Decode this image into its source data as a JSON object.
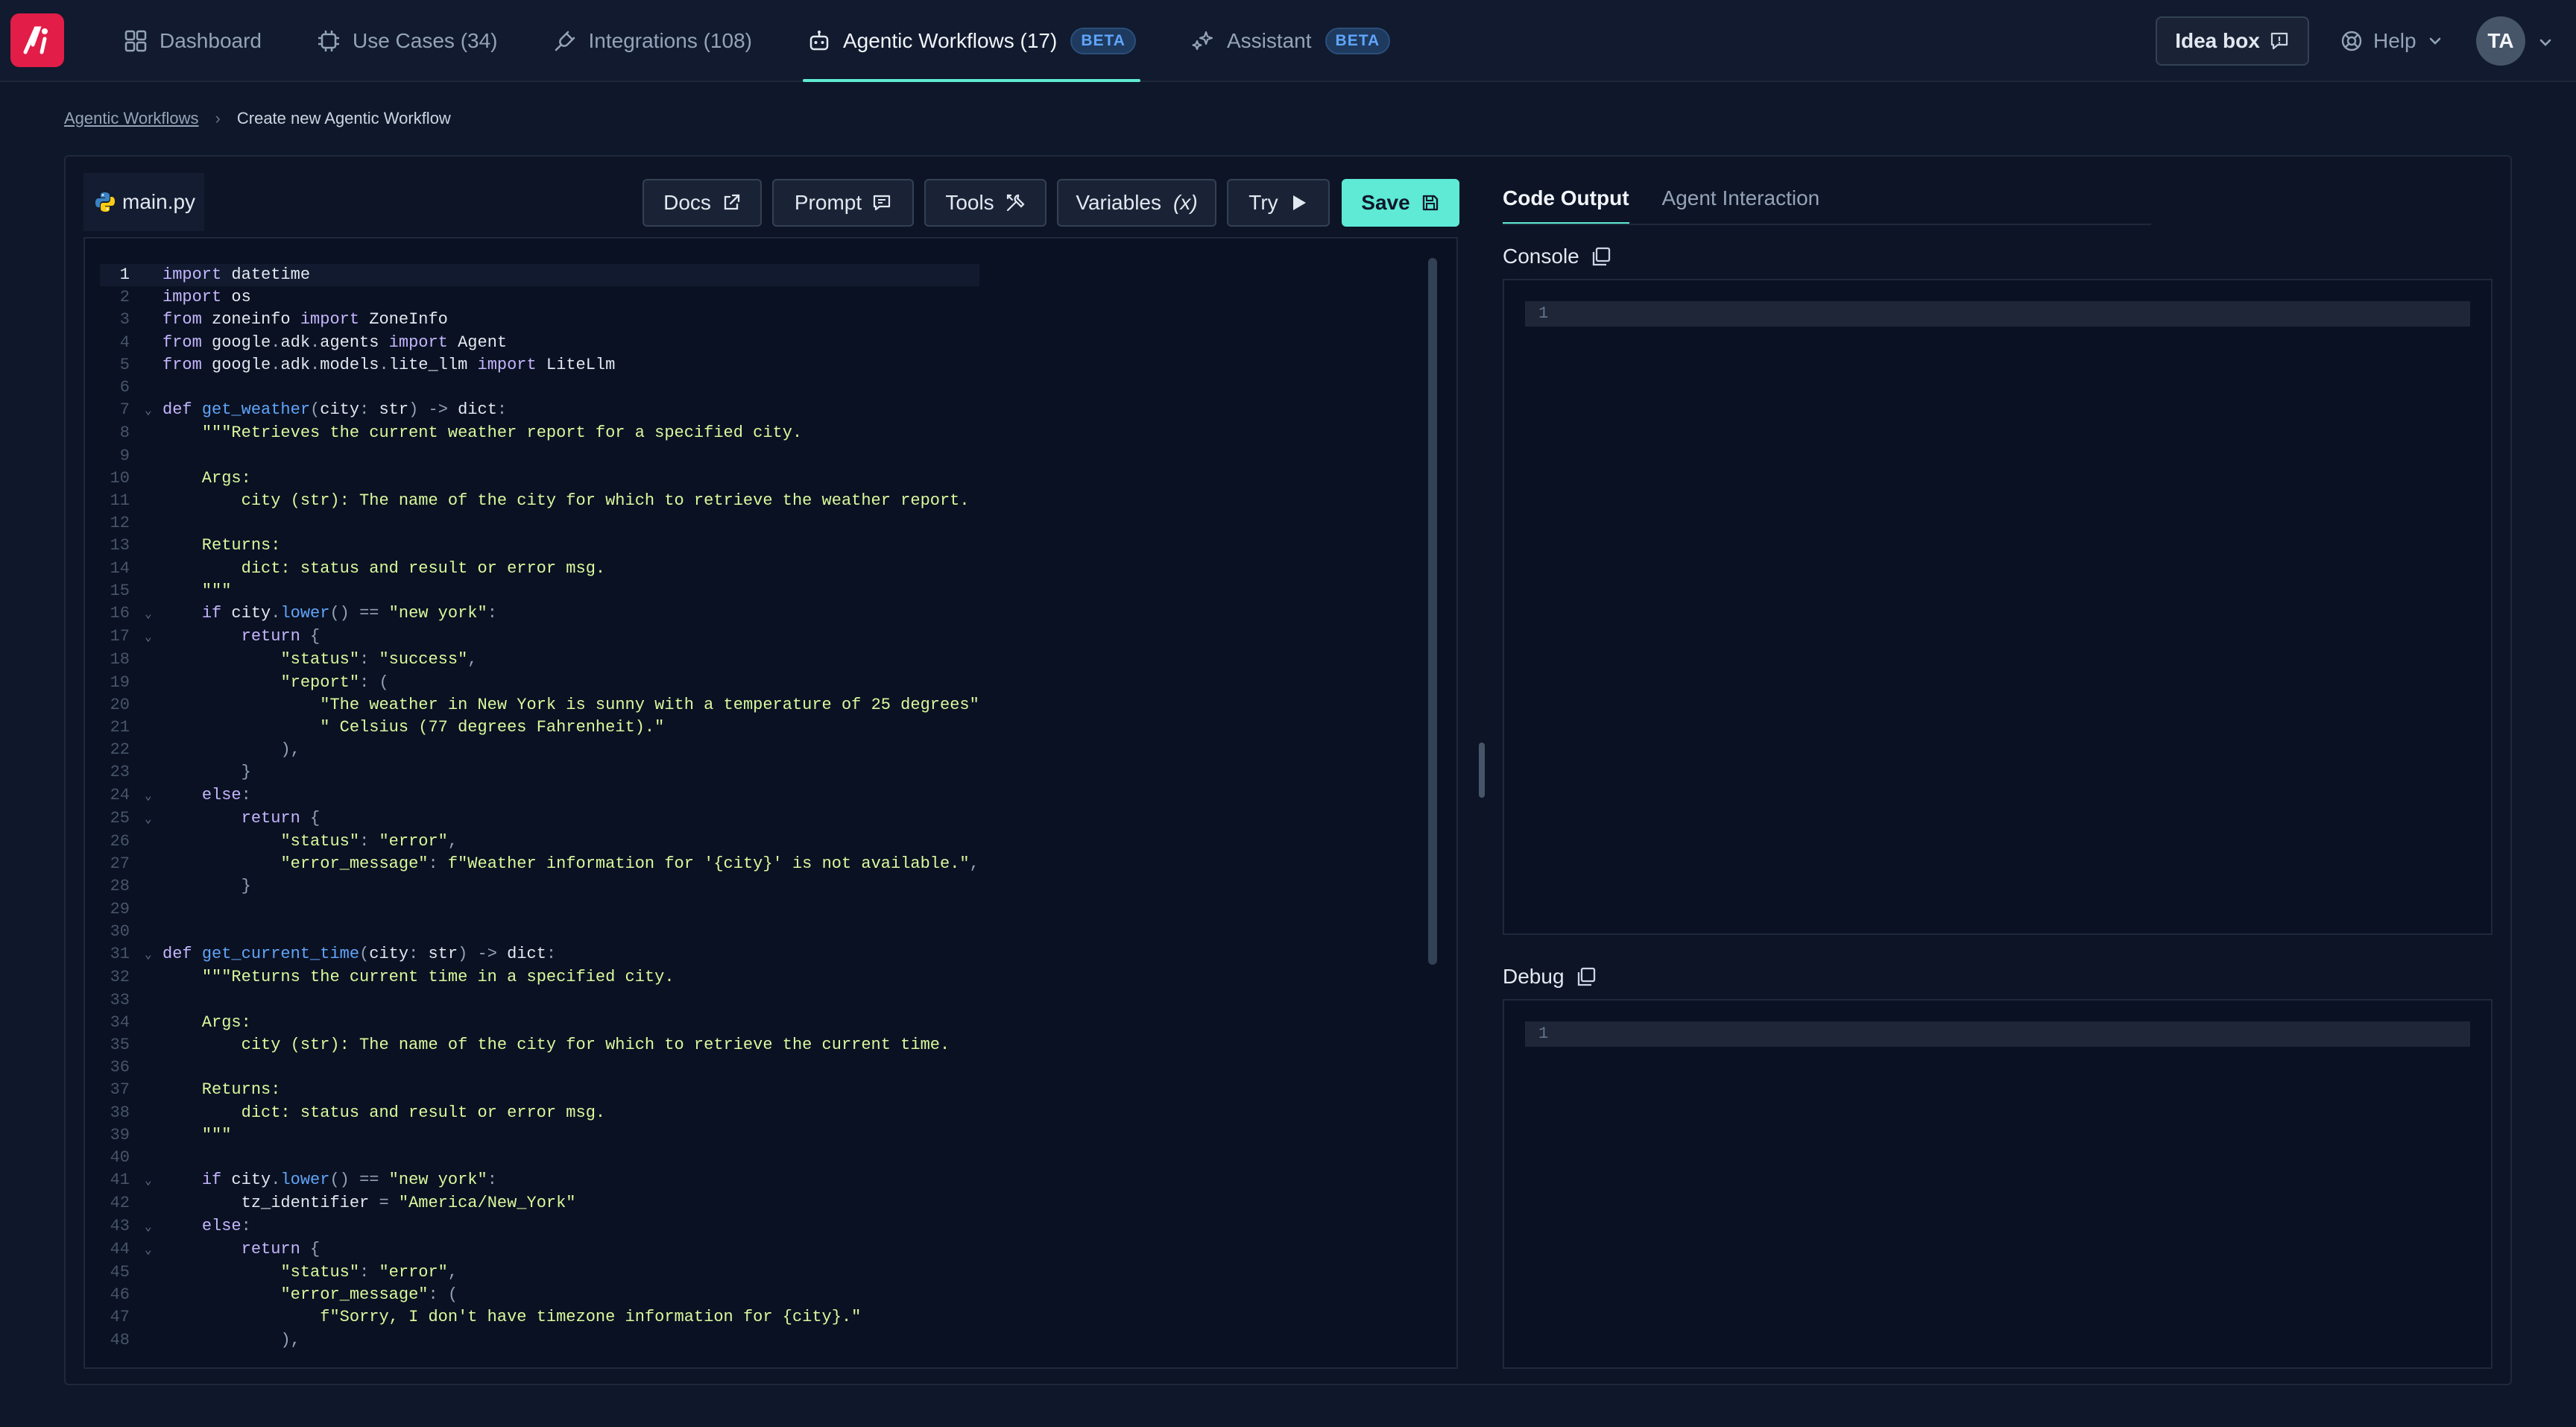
{
  "topbar": {
    "nav": [
      {
        "label": "Dashboard",
        "icon": "dashboard-icon"
      },
      {
        "label": "Use Cases (34)",
        "icon": "chip-icon"
      },
      {
        "label": "Integrations (108)",
        "icon": "plug-icon"
      },
      {
        "label": "Agentic Workflows (17)",
        "icon": "robot-icon",
        "badge": "BETA",
        "active": true
      },
      {
        "label": "Assistant",
        "icon": "sparkle-icon",
        "badge": "BETA"
      }
    ],
    "idea_box": "Idea box",
    "help": "Help",
    "avatar": "TA"
  },
  "breadcrumb": {
    "parent": "Agentic Workflows",
    "current": "Create new Agentic Workflow"
  },
  "editor": {
    "file_tab": "main.py",
    "toolbar": {
      "docs": "Docs",
      "prompt": "Prompt",
      "tools": "Tools",
      "variables": "Variables",
      "variables_glyph": "(x)",
      "try": "Try",
      "save": "Save"
    },
    "lines": [
      "import datetime",
      "import os",
      "from zoneinfo import ZoneInfo",
      "from google.adk.agents import Agent",
      "from google.adk.models.lite_llm import LiteLlm",
      "",
      "def get_weather(city: str) -> dict:",
      "    \"\"\"Retrieves the current weather report for a specified city.",
      "",
      "    Args:",
      "        city (str): The name of the city for which to retrieve the weather report.",
      "",
      "    Returns:",
      "        dict: status and result or error msg.",
      "    \"\"\"",
      "    if city.lower() == \"new york\":",
      "        return {",
      "            \"status\": \"success\",",
      "            \"report\": (",
      "                \"The weather in New York is sunny with a temperature of 25 degrees\"",
      "                \" Celsius (77 degrees Fahrenheit).\"",
      "            ),",
      "        }",
      "    else:",
      "        return {",
      "            \"status\": \"error\",",
      "            \"error_message\": f\"Weather information for '{city}' is not available.\",",
      "        }",
      "",
      "",
      "def get_current_time(city: str) -> dict:",
      "    \"\"\"Returns the current time in a specified city.",
      "",
      "    Args:",
      "        city (str): The name of the city for which to retrieve the current time.",
      "",
      "    Returns:",
      "        dict: status and result or error msg.",
      "    \"\"\"",
      "",
      "    if city.lower() == \"new york\":",
      "        tz_identifier = \"America/New_York\"",
      "    else:",
      "        return {",
      "            \"status\": \"error\",",
      "            \"error_message\": (",
      "                f\"Sorry, I don't have timezone information for {city}.\"",
      "            ),"
    ],
    "fold_lines": [
      7,
      16,
      17,
      24,
      25,
      31,
      41,
      43,
      44
    ]
  },
  "output": {
    "tabs": [
      "Code Output",
      "Agent Interaction"
    ],
    "console_label": "Console",
    "console_line": "1",
    "debug_label": "Debug",
    "debug_line": "1"
  }
}
